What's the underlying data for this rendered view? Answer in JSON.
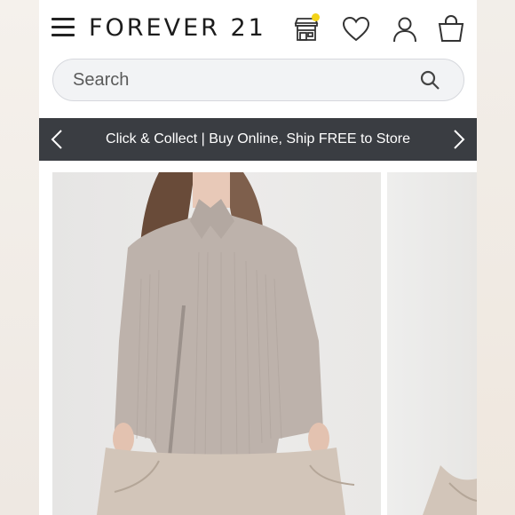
{
  "header": {
    "logo": "FOREVER 21",
    "icons": [
      "menu-icon",
      "store-icon",
      "heart-icon",
      "user-icon",
      "bag-icon"
    ]
  },
  "search": {
    "placeholder": "Search"
  },
  "promo": {
    "text": "Click & Collect | Buy Online, Ship FREE to Store"
  },
  "products": [
    {
      "image": "zip-up-ribbed-sweater-photo"
    },
    {
      "image": "product-photo-partial"
    }
  ],
  "colors": {
    "promo_bg": "#3a3d42",
    "badge": "#f3d318",
    "text": "#1c1c1c"
  }
}
